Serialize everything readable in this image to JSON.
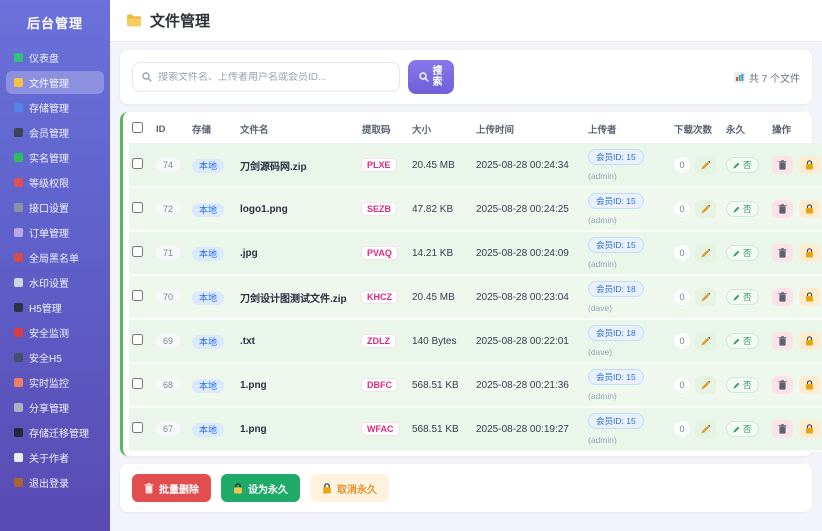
{
  "colors": {
    "sidebar_top": "#6a71da",
    "sidebar_bottom": "#5a4ab3",
    "accent_purple": "#6f5fd8",
    "row_green": "#eaf6e9",
    "strip_green": "#57b661",
    "danger_red": "#e24d4d",
    "success_green": "#1faa67",
    "warn_orange": "#e8912d",
    "code_pink": "#e02a7e",
    "badge_blue": "#2f6fe4"
  },
  "sidebar": {
    "title": "后台管理",
    "items": [
      {
        "icon": "dashboard-icon",
        "icon_color": "#34c27a",
        "label": "仪表盘",
        "active": false
      },
      {
        "icon": "folder-icon",
        "icon_color": "#f6c244",
        "label": "文件管理",
        "active": true
      },
      {
        "icon": "storage-icon",
        "icon_color": "#4f86e8",
        "label": "存储管理",
        "active": false
      },
      {
        "icon": "members-icon",
        "icon_color": "#3c4455",
        "label": "会员管理",
        "active": false
      },
      {
        "icon": "verify-icon",
        "icon_color": "#2ebd59",
        "label": "实名管理",
        "active": false
      },
      {
        "icon": "level-icon",
        "icon_color": "#e05252",
        "label": "等级权限",
        "active": false
      },
      {
        "icon": "api-icon",
        "icon_color": "#8a93a5",
        "label": "接口设置",
        "active": false
      },
      {
        "icon": "order-icon",
        "icon_color": "#b9a7e8",
        "label": "订单管理",
        "active": false
      },
      {
        "icon": "blacklist-icon",
        "icon_color": "#d84b4b",
        "label": "全局黑名单",
        "active": false
      },
      {
        "icon": "watermark-icon",
        "icon_color": "#cfd5de",
        "label": "水印设置",
        "active": false
      },
      {
        "icon": "h5-icon",
        "icon_color": "#2b3344",
        "label": "H5管理",
        "active": false
      },
      {
        "icon": "security-icon",
        "icon_color": "#d8403f",
        "label": "安全监测",
        "active": false
      },
      {
        "icon": "security-h5-icon",
        "icon_color": "#44506a",
        "label": "安全H5",
        "active": false
      },
      {
        "icon": "monitor-icon",
        "icon_color": "#ef7d66",
        "label": "实时监控",
        "active": false
      },
      {
        "icon": "share-icon",
        "icon_color": "#aab2bf",
        "label": "分享管理",
        "active": false
      },
      {
        "icon": "migrate-icon",
        "icon_color": "#222a3a",
        "label": "存储迁移管理",
        "active": false
      },
      {
        "icon": "author-icon",
        "icon_color": "#e9edf4",
        "label": "关于作者",
        "active": false
      },
      {
        "icon": "logout-icon",
        "icon_color": "#a9652f",
        "label": "退出登录",
        "active": false
      }
    ]
  },
  "header": {
    "icon": "folder-icon",
    "title": "文件管理"
  },
  "search": {
    "input_icon": "search-icon",
    "placeholder": "搜索文件名、上传者用户名或会员ID...",
    "button_icon": "search-icon",
    "button_label": "搜索",
    "count_icon": "bar-chart-icon",
    "file_count": "共 7 个文件"
  },
  "table": {
    "columns": {
      "id": "ID",
      "storage": "存储",
      "filename": "文件名",
      "code": "提取码",
      "size": "大小",
      "time": "上传时间",
      "uploader": "上传者",
      "downloads": "下载次数",
      "permanent": "永久",
      "ops": "操作"
    },
    "permanent_value": "否",
    "rows": [
      {
        "id": "74",
        "storage": "本地",
        "filename": "刀剑源码网.zip",
        "code": "PLXE",
        "size": "20.45 MB",
        "time": "2025-08-28 00:24:34",
        "uploader": "会员ID: 15",
        "uploader_sub": "(admin)",
        "downloads": "0",
        "permanent": "否"
      },
      {
        "id": "72",
        "storage": "本地",
        "filename": "logo1.png",
        "code": "SEZB",
        "size": "47.82 KB",
        "time": "2025-08-28 00:24:25",
        "uploader": "会员ID: 15",
        "uploader_sub": "(admin)",
        "downloads": "0",
        "permanent": "否"
      },
      {
        "id": "71",
        "storage": "本地",
        "filename": ".jpg",
        "code": "PVAQ",
        "size": "14.21 KB",
        "time": "2025-08-28 00:24:09",
        "uploader": "会员ID: 15",
        "uploader_sub": "(admin)",
        "downloads": "0",
        "permanent": "否"
      },
      {
        "id": "70",
        "storage": "本地",
        "filename": "刀剑设计图测试文件.zip",
        "code": "KHCZ",
        "size": "20.45 MB",
        "time": "2025-08-28 00:23:04",
        "uploader": "会员ID: 18",
        "uploader_sub": "(dave)",
        "downloads": "0",
        "permanent": "否"
      },
      {
        "id": "69",
        "storage": "本地",
        "filename": ".txt",
        "code": "ZDLZ",
        "size": "140 Bytes",
        "time": "2025-08-28 00:22:01",
        "uploader": "会员ID: 18",
        "uploader_sub": "(dave)",
        "downloads": "0",
        "permanent": "否"
      },
      {
        "id": "68",
        "storage": "本地",
        "filename": "1.png",
        "code": "DBFC",
        "size": "568.51 KB",
        "time": "2025-08-28 00:21:36",
        "uploader": "会员ID: 15",
        "uploader_sub": "(admin)",
        "downloads": "0",
        "permanent": "否"
      },
      {
        "id": "67",
        "storage": "本地",
        "filename": "1.png",
        "code": "WFAC",
        "size": "568.51 KB",
        "time": "2025-08-28 00:19:27",
        "uploader": "会员ID: 15",
        "uploader_sub": "(admin)",
        "downloads": "0",
        "permanent": "否"
      }
    ]
  },
  "footer": {
    "actions": [
      {
        "icon": "trash-icon",
        "label": "批量删除"
      },
      {
        "icon": "lock-icon",
        "label": "设为永久"
      },
      {
        "icon": "lock-icon",
        "label": "取消永久"
      }
    ]
  }
}
